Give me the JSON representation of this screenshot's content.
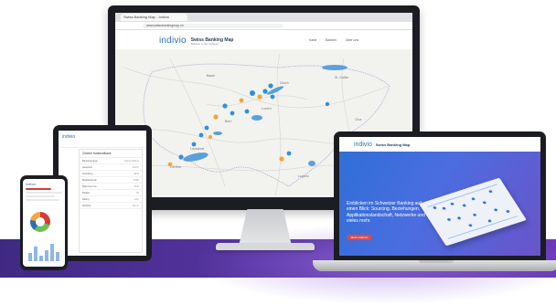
{
  "colors": {
    "brand_blue": "#2e6fb5",
    "marker_blue": "#2f8fe0",
    "marker_orange": "#f2a73b",
    "lake_blue": "#5aa0db",
    "hero_blue": "#3b6fe0",
    "purple_band": "#4b2f96",
    "cta_red": "#e04848"
  },
  "monitor": {
    "tab_label": "Swiss Banking Map - Indivio",
    "url": "www.swissbankingmap.ch",
    "logo": "indivio",
    "app_title": "Swiss Banking Map",
    "app_subtitle": "Banken in der Schweiz",
    "nav": [
      "Karte",
      "Banken",
      "Über uns"
    ],
    "map_place_labels": [
      "Basel",
      "Zürich",
      "Bern",
      "Luzern",
      "Lausanne",
      "Genève",
      "Lugano",
      "St. Gallen",
      "Chur"
    ]
  },
  "tablet": {
    "logo": "indivio",
    "card_title": "Zürcher Kantonalbank",
    "rows": [
      {
        "k": "Bankengruppe",
        "v": "Kantonalbank"
      },
      {
        "k": "Hauptsitz",
        "v": "Zürich"
      },
      {
        "k": "Gründung",
        "v": "1870"
      },
      {
        "k": "Mitarbeitende",
        "v": "5'200"
      },
      {
        "k": "Bilanzsumme",
        "v": "CHF"
      },
      {
        "k": "Filialen",
        "v": "60"
      },
      {
        "k": "Rating",
        "v": "AAA"
      },
      {
        "k": "Website",
        "v": "zkb.ch"
      }
    ]
  },
  "phone": {
    "logo": "indivio",
    "bars": [
      0.45,
      0.8,
      0.3,
      0.6,
      0.95,
      0.5
    ]
  },
  "laptop": {
    "logo": "indivio",
    "app_title": "Swiss Banking Map",
    "hero_text": "Einblicken im Schweizer Banking auf einen Blick: Sourcing, Beziehungen, Applikationslandschaft, Netzwerke und vieles mehr.",
    "cta_label": "Mehr erfahren"
  }
}
